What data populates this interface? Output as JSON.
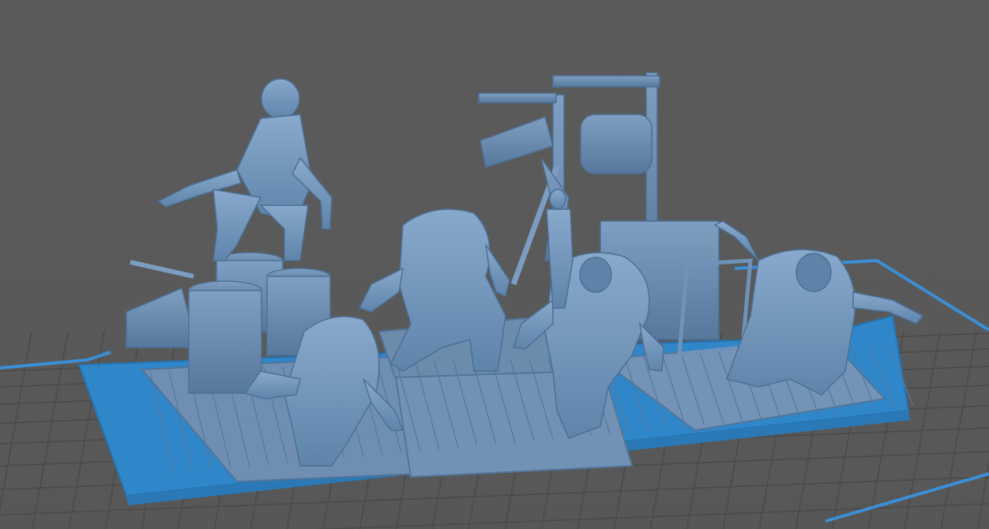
{
  "viewport": {
    "background_color": "#5a5a5a",
    "grid_line_color": "#4a4a4a",
    "build_plate_outline_color": "#3b8fd6",
    "base_color": "#2e88cf",
    "model_color": "#6f93b8"
  },
  "models": [
    {
      "name": "ghoul-on-barrels",
      "base_shape": "rectangle"
    },
    {
      "name": "hunched-ghoul-left",
      "base_shape": "rectangle"
    },
    {
      "name": "hunched-ghoul-middle",
      "base_shape": "rectangle"
    },
    {
      "name": "hunched-ghoul-center",
      "base_shape": "rectangle"
    },
    {
      "name": "hunched-ghoul-right",
      "base_shape": "rectangle"
    },
    {
      "name": "tavern-sign-and-barrel-scenery",
      "base_shape": "rectangle"
    }
  ]
}
